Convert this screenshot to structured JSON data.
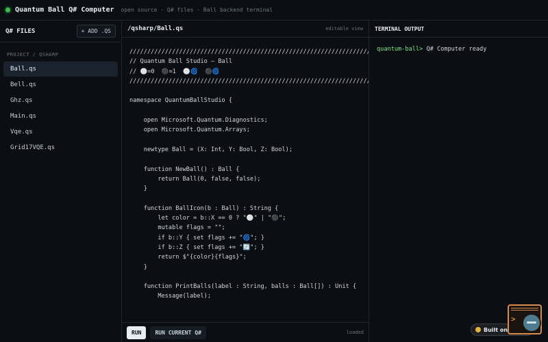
{
  "app": {
    "title": "Quantum Ball Q# Computer",
    "subtitle": "open source · Q# files · Ball backend terminal"
  },
  "sidebar": {
    "title": "Q# FILES",
    "add_label": "+ ADD .QS",
    "project_label": "PROJECT / QSHARP",
    "files": [
      {
        "label": "Ball.qs",
        "active": true
      },
      {
        "label": "Bell.qs",
        "active": false
      },
      {
        "label": "Ghz.qs",
        "active": false
      },
      {
        "label": "Main.qs",
        "active": false
      },
      {
        "label": "Vqe.qs",
        "active": false
      },
      {
        "label": "Grid17VQE.qs",
        "active": false
      }
    ]
  },
  "editor": {
    "path": "/qsharp/Ball.qs",
    "mode": "editable view",
    "code": "//////////////////////////////////////////////////////////////////////////\n// Quantum Ball Studio — Ball\n// ⚪=0  ⚫=1  ⚪🌀  ⚫🌀\n//////////////////////////////////////////////////////////////////////////\n\nnamespace QuantumBallStudio {\n\n    open Microsoft.Quantum.Diagnostics;\n    open Microsoft.Quantum.Arrays;\n\n    newtype Ball = (X: Int, Y: Bool, Z: Bool);\n\n    function NewBall() : Ball {\n        return Ball(0, false, false);\n    }\n\n    function BallIcon(b : Ball) : String {\n        let color = b::X == 0 ? \"⚪\" | \"⚫\";\n        mutable flags = \"\";\n        if b::Y { set flags += \"🌀\"; }\n        if b::Z { set flags += \"🔄\"; }\n        return $\"{color}{flags}\";\n    }\n\n    function PrintBalls(label : String, balls : Ball[]) : Unit {\n        Message(label);",
    "run_label": "RUN",
    "run_current_label": "RUN CURRENT Q#",
    "status": "loaded"
  },
  "terminal": {
    "title": "TERMINAL OUTPUT",
    "prompt": "quantum-ball>",
    "line": " Q# Computer ready"
  },
  "badge": {
    "label": "Built on Hatch"
  },
  "icons": {
    "status_dot": "online-dot-icon",
    "badge_icon": "hatch-logo-icon",
    "fab_icon": "terminal-chat-icon"
  },
  "colors": {
    "accent_green": "#7ee787",
    "fab_orange": "#d88b4a"
  }
}
